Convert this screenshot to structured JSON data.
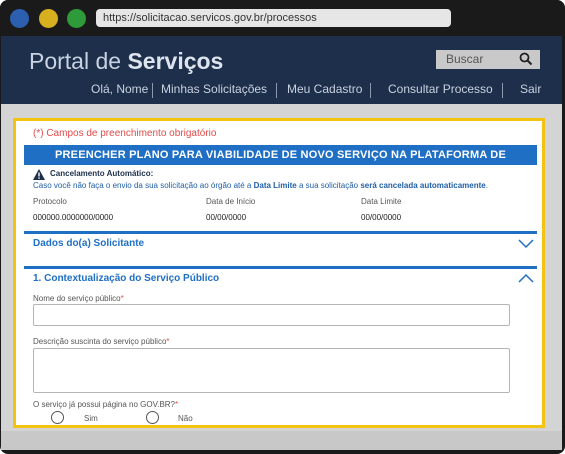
{
  "browser": {
    "url": "https://solicitacao.servicos.gov.br/processos",
    "dot_colors": [
      "#2d5fb0",
      "#d6b01e",
      "#2f9a3a"
    ]
  },
  "header": {
    "brand_prefix": "Portal de",
    "brand_bold": "Serviços",
    "search_placeholder": "Buscar",
    "search_icon": "search-icon",
    "nav": [
      "Olá, Nome",
      "Minhas Solicitações",
      "Meu Cadastro",
      "Consultar Processo",
      "Sair"
    ]
  },
  "form": {
    "required_note": "(*) Campos de preenchimento obrigatório",
    "title": "PREENCHER PLANO PARA VIABILIDADE DE NOVO SERVIÇO NA PLATAFORMA DE AUTOMAÇÃO",
    "warning": {
      "icon": "warning-icon",
      "title": "Cancelamento Automático:",
      "text_1": "Caso você não faça o envio da sua solicitação ao órgão até a ",
      "text_bold_1": "Data Limite",
      "text_2": " a sua solicitação ",
      "text_bold_2": "será cancelada automaticamente",
      "text_3": "."
    },
    "meta": [
      {
        "label": "Protocolo",
        "value": "000000.0000000/0000"
      },
      {
        "label": "Data de Início",
        "value": "00/00/0000"
      },
      {
        "label": "Data Limite",
        "value": "00/00/0000"
      }
    ],
    "sections": [
      {
        "title": "Dados do(a) Solicitante",
        "state": "collapsed",
        "icon": "chevron-down-icon"
      },
      {
        "title": "1. Contextualização do Serviço Público",
        "state": "expanded",
        "icon": "chevron-up-icon"
      }
    ],
    "fields": {
      "service_name": {
        "label": "Nome do serviço público",
        "required_mark": "*",
        "value": ""
      },
      "description": {
        "label": "Descrição suscinta do serviço público",
        "required_mark": "*",
        "value": ""
      },
      "has_page": {
        "label": "O serviço já possui página no GOV.BR?",
        "required_mark": "*",
        "options": [
          "Sim",
          "Não"
        ]
      }
    }
  },
  "colors": {
    "header_bg": "#1d2f4a",
    "accent_blue": "#1f6fc5",
    "panel_border": "#f2c40f",
    "required_red": "#e14b4b"
  }
}
